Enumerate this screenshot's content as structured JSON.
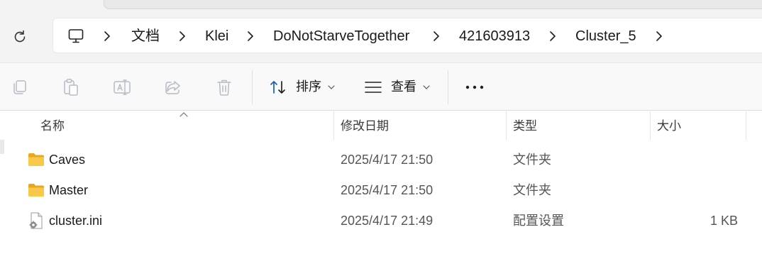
{
  "address_bar": {
    "breadcrumbs": [
      "文档",
      "Klei",
      "DoNotStarveTogether",
      "421603913",
      "Cluster_5"
    ]
  },
  "toolbar": {
    "sort_label": "排序",
    "view_label": "查看"
  },
  "columns": {
    "name": "名称",
    "modified": "修改日期",
    "type": "类型",
    "size": "大小"
  },
  "files": [
    {
      "name": "Caves",
      "modified": "2025/4/17 21:50",
      "type": "文件夹",
      "size": "",
      "icon": "folder-icon"
    },
    {
      "name": "Master",
      "modified": "2025/4/17 21:50",
      "type": "文件夹",
      "size": "",
      "icon": "folder-icon"
    },
    {
      "name": "cluster.ini",
      "modified": "2025/4/17 21:49",
      "type": "配置设置",
      "size": "1 KB",
      "icon": "settings-file-icon"
    }
  ],
  "colors": {
    "folder": "#f8c84a",
    "folder_dark": "#e8a81c",
    "accent": "#1a5fb4"
  }
}
